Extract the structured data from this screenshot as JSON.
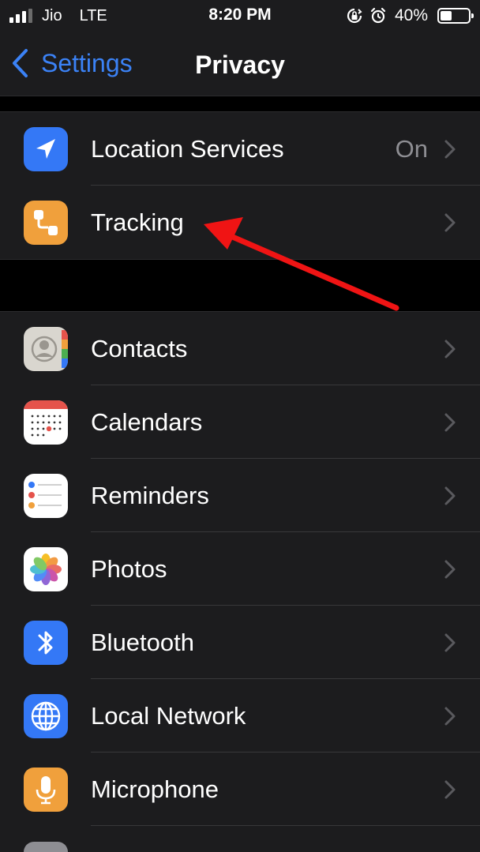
{
  "status_bar": {
    "carrier": "Jio",
    "network": "LTE",
    "time": "8:20 PM",
    "battery_percent": "40%",
    "battery_level": 0.4,
    "signal_bars": 3,
    "signal_bars_max": 4
  },
  "nav": {
    "back_label": "Settings",
    "title": "Privacy"
  },
  "colors": {
    "accent": "#3b82f6",
    "annotation_arrow": "#f01414"
  },
  "groups": [
    {
      "items": [
        {
          "label": "Location Services",
          "value": "On",
          "icon": "location-arrow-icon"
        },
        {
          "label": "Tracking",
          "value": "",
          "icon": "tracking-icon"
        }
      ]
    },
    {
      "items": [
        {
          "label": "Contacts",
          "icon": "contacts-icon"
        },
        {
          "label": "Calendars",
          "icon": "calendar-icon"
        },
        {
          "label": "Reminders",
          "icon": "reminders-icon"
        },
        {
          "label": "Photos",
          "icon": "photos-icon"
        },
        {
          "label": "Bluetooth",
          "icon": "bluetooth-icon"
        },
        {
          "label": "Local Network",
          "icon": "globe-icon"
        },
        {
          "label": "Microphone",
          "icon": "microphone-icon"
        }
      ]
    }
  ]
}
